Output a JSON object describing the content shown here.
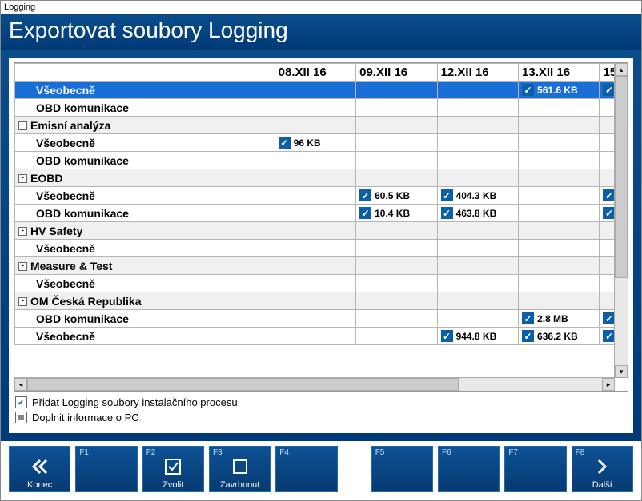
{
  "window_title": "Logging",
  "header_title": "Exportovat soubory Logging",
  "columns": [
    "08.XII 16",
    "09.XII 16",
    "12.XII 16",
    "13.XII 16",
    "15"
  ],
  "rows": [
    {
      "type": "child",
      "label": "Všeobecně",
      "selected": true,
      "cells": [
        null,
        null,
        null,
        {
          "checked": true,
          "size": "561.6 KB"
        },
        {
          "checked": true
        }
      ]
    },
    {
      "type": "child",
      "label": "OBD komunikace",
      "cells": [
        null,
        null,
        null,
        null,
        null
      ]
    },
    {
      "type": "group",
      "label": "Emisní analýza"
    },
    {
      "type": "child",
      "label": "Všeobecně",
      "cells": [
        {
          "checked": true,
          "size": "96 KB"
        },
        null,
        null,
        null,
        null
      ]
    },
    {
      "type": "child",
      "label": "OBD komunikace",
      "cells": [
        null,
        null,
        null,
        null,
        null
      ]
    },
    {
      "type": "group",
      "label": "EOBD"
    },
    {
      "type": "child",
      "label": "Všeobecně",
      "cells": [
        null,
        {
          "checked": true,
          "size": "60.5 KB"
        },
        {
          "checked": true,
          "size": "404.3 KB"
        },
        null,
        {
          "checked": true
        }
      ]
    },
    {
      "type": "child",
      "label": "OBD komunikace",
      "cells": [
        null,
        {
          "checked": true,
          "size": "10.4 KB"
        },
        {
          "checked": true,
          "size": "463.8 KB"
        },
        null,
        {
          "checked": true
        }
      ]
    },
    {
      "type": "group",
      "label": "HV Safety"
    },
    {
      "type": "child",
      "label": "Všeobecně",
      "cells": [
        null,
        null,
        null,
        null,
        null
      ]
    },
    {
      "type": "group",
      "label": "Measure & Test"
    },
    {
      "type": "child",
      "label": "Všeobecně",
      "cells": [
        null,
        null,
        null,
        null,
        null
      ]
    },
    {
      "type": "group",
      "label": "OM Česká Republika"
    },
    {
      "type": "child",
      "label": "OBD komunikace",
      "cells": [
        null,
        null,
        null,
        {
          "checked": true,
          "size": "2.8 MB"
        },
        {
          "checked": true
        }
      ]
    },
    {
      "type": "child",
      "label": "Všeobecně",
      "cells": [
        null,
        null,
        {
          "checked": true,
          "size": "944.8 KB"
        },
        {
          "checked": true,
          "size": "636.2 KB"
        },
        {
          "checked": true
        }
      ]
    }
  ],
  "options": {
    "opt1": {
      "label": "Přidat Logging soubory instalačního procesu",
      "state": "on"
    },
    "opt2": {
      "label": "Doplnit informace o PC",
      "state": "ind"
    }
  },
  "fkeys": {
    "konec": "Konec",
    "f1": "F1",
    "f2": "F2",
    "f3": "F3",
    "f4": "F4",
    "f5": "F5",
    "f6": "F6",
    "f7": "F7",
    "f8": "F8",
    "zvolit": "Zvolit",
    "zavrhnout": "Zavrhnout",
    "dalsi": "Další"
  }
}
